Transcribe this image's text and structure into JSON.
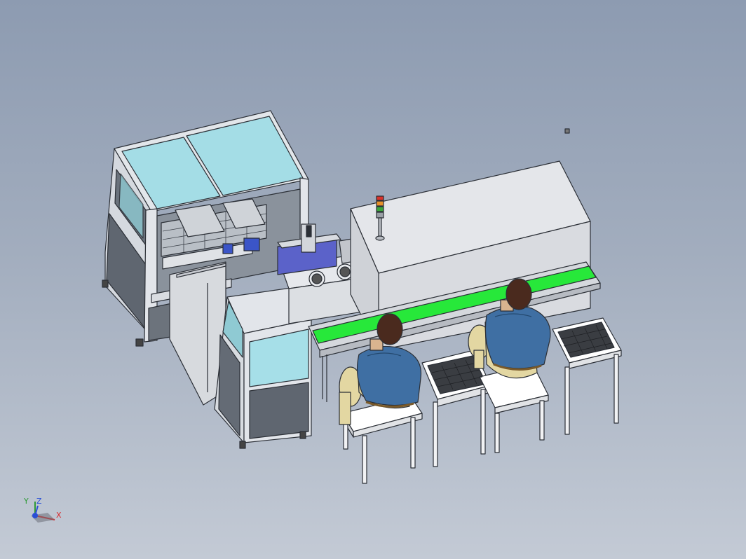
{
  "viewport": {
    "background_top": "#8d9bb1",
    "background_bottom": "#c3cad5"
  },
  "triad": {
    "x_label": "X",
    "y_label": "Y",
    "z_label": "Z",
    "x_color": "#d8262a",
    "y_color": "#2e9a36",
    "z_color": "#2a4fd6"
  },
  "colors": {
    "frame": "#e2e5ea",
    "glass": "#a4dde6",
    "conveyor_belt": "#27e83a",
    "machine_body": "#d9dbe0",
    "motor_block": "#5b62c9",
    "operator_shirt": "#3f6fa3",
    "operator_pants": "#e3d7a2",
    "operator_hair": "#4a2a1e"
  },
  "signal_tower": {
    "lamps": [
      "#d9332b",
      "#e8912a",
      "#3ba53b",
      "#9aa0a6"
    ]
  }
}
